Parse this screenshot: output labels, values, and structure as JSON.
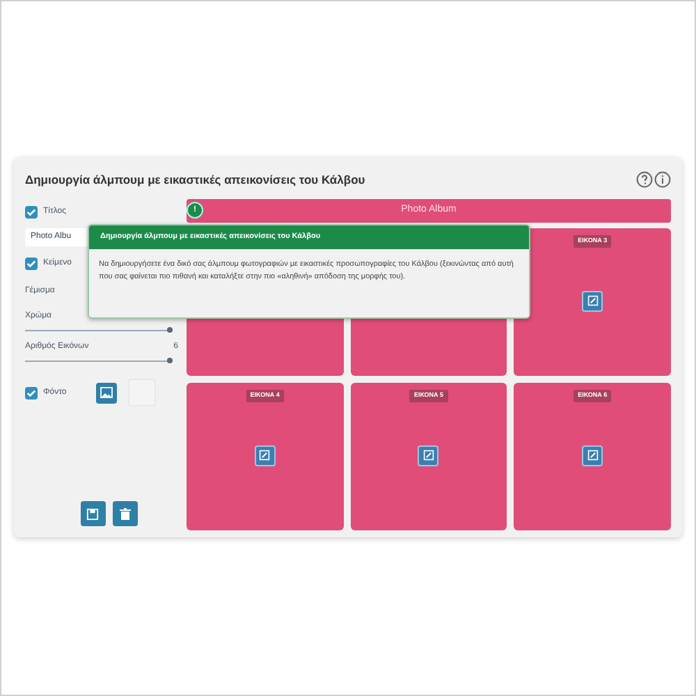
{
  "panel": {
    "title": "Δημιουργία άλμπουμ με εικαστικές απεικονίσεις του Κάλβου"
  },
  "controls": [
    {
      "kind": "checkbox",
      "label": "Τίτλος",
      "checked": true
    },
    {
      "kind": "input",
      "value": "Photo Albu"
    },
    {
      "kind": "checkbox",
      "label": "Κείμενο",
      "checked": true
    },
    {
      "kind": "label",
      "label": "Γέμισμα"
    },
    {
      "kind": "slider",
      "label": "Χρώμα",
      "level": 1
    },
    {
      "kind": "slider",
      "label": "Αριθμός Εικόνων",
      "reading": "6",
      "level": 1
    },
    {
      "kind": "background",
      "label": "Φόντο",
      "checked": true
    }
  ],
  "album": {
    "title": "Photo Album",
    "tiles": [
      {
        "kind": "covered"
      },
      {
        "kind": "covered"
      },
      {
        "kind": "image",
        "label": "ΕΙΚΟΝΑ 3"
      },
      {
        "kind": "image",
        "label": "ΕΙΚΟΝΑ 4"
      },
      {
        "kind": "image",
        "label": "ΕΙΚΟΝΑ 5"
      },
      {
        "kind": "image",
        "label": "ΕΙΚΟΝΑ 6"
      }
    ]
  },
  "tooltip": {
    "marker": "!",
    "title": "Δημιουργία άλμπουμ με εικαστικές απεικονίσεις του Κάλβου",
    "text": "Να δημιουργήσετε ένα δικό σας άλμπουμ φωτογραφιών με εικαστικές προσωπογραφίες του Κάλβου (ξεκινώντας από αυτή που σας φαίνεται πιο πιθανή και καταλήξτε στην πιο «αληθινή» απόδοση της μορφής του)."
  }
}
